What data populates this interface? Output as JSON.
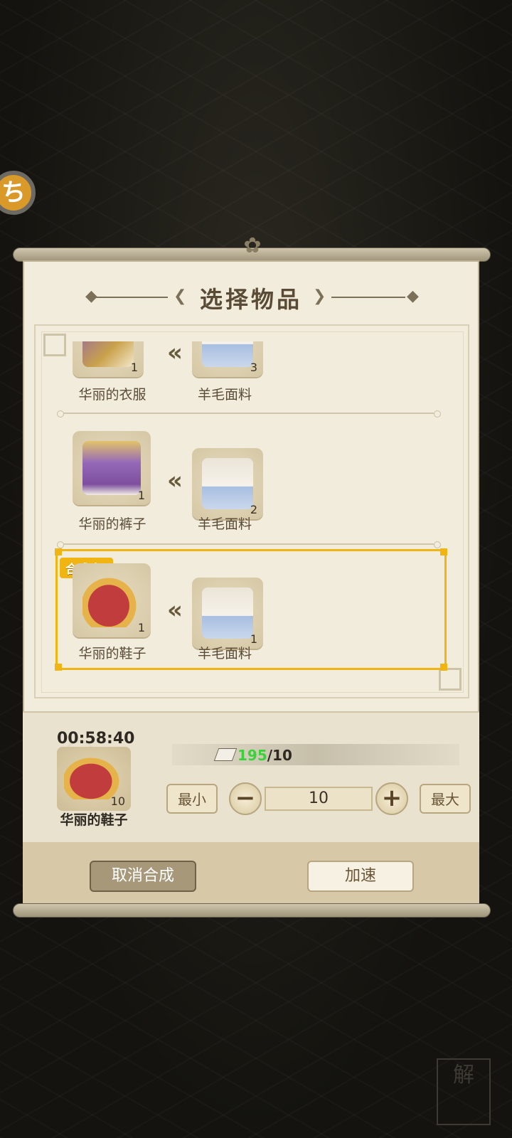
{
  "dialog": {
    "title": "选择物品"
  },
  "recipes": [
    {
      "product": {
        "name": "华丽的衣服",
        "count": "1",
        "icon": "fancy-clothes-icon"
      },
      "material": {
        "name": "羊毛面料",
        "count": "3",
        "icon": "wool-fabric-icon"
      }
    },
    {
      "product": {
        "name": "华丽的裤子",
        "count": "1",
        "icon": "fancy-pants-icon"
      },
      "material": {
        "name": "羊毛面料",
        "count": "2",
        "icon": "wool-fabric-icon"
      }
    },
    {
      "product": {
        "name": "华丽的鞋子",
        "count": "1",
        "icon": "fancy-shoes-icon"
      },
      "material": {
        "name": "羊毛面料",
        "count": "1",
        "icon": "wool-fabric-icon"
      },
      "badge": "合成中!"
    }
  ],
  "crafting": {
    "timer": "00:58:40",
    "item_name": "华丽的鞋子",
    "item_count": "10",
    "resource_have": "195",
    "resource_need": "/10",
    "quantity": "10",
    "min_label": "最小",
    "max_label": "最大"
  },
  "actions": {
    "cancel_label": "取消合成",
    "speedup_label": "加速"
  },
  "side_button_glyph": "ち",
  "corner_seal_text": "解"
}
